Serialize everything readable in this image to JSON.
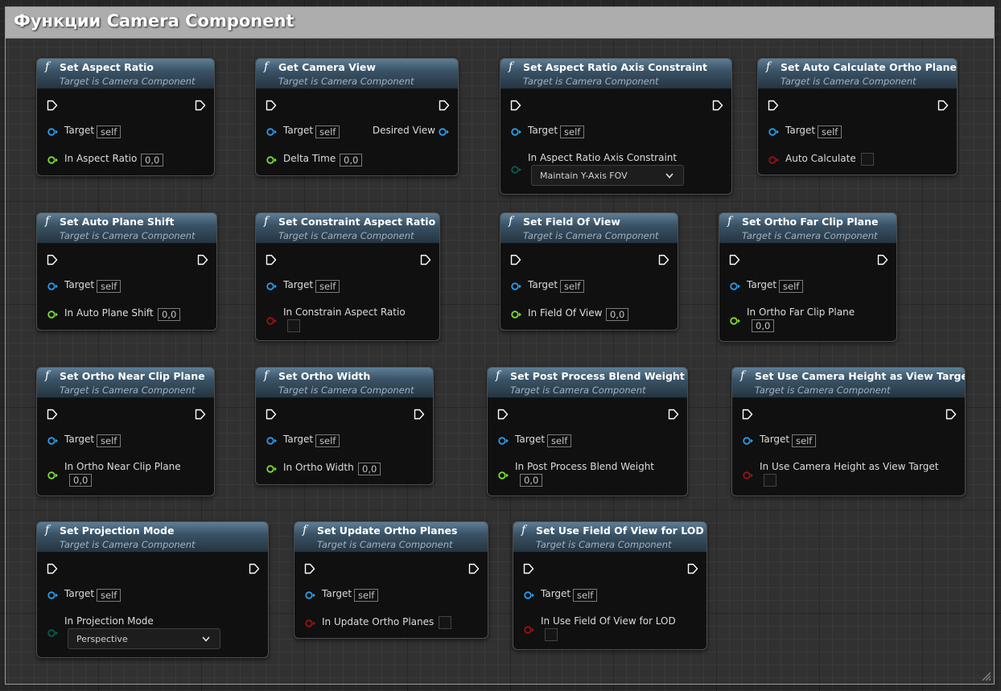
{
  "comment": {
    "title": "Функции Camera Component"
  },
  "subtitle": "Target is Camera Component",
  "target_label": "Target",
  "self_value": "self",
  "colors": {
    "object_pin": "#2a9be9",
    "float_pin": "#7bdc34",
    "bool_pin": "#9a1212",
    "enum_pin": "#0a5a4c",
    "header": "#3a5366"
  },
  "icons": {
    "function": "f",
    "exec": "exec-pin-icon",
    "dropdown": "chevron-down-icon"
  },
  "nodes": [
    {
      "title": "Set Aspect Ratio",
      "param": "In Aspect Ratio",
      "value": "0,0"
    },
    {
      "title": "Get Camera View",
      "param": "Delta Time",
      "value": "0,0",
      "output": "Desired View"
    },
    {
      "title": "Set Aspect Ratio Axis Constraint",
      "param": "In Aspect Ratio Axis Constraint",
      "value": "Maintain Y-Axis FOV"
    },
    {
      "title": "Set Auto Calculate Ortho Planes",
      "param": "Auto Calculate"
    },
    {
      "title": "Set Auto Plane Shift",
      "param": "In Auto Plane Shift",
      "value": "0,0"
    },
    {
      "title": "Set Constraint Aspect Ratio",
      "param": "In Constrain Aspect Ratio"
    },
    {
      "title": "Set Field Of View",
      "param": "In Field Of View",
      "value": "0,0"
    },
    {
      "title": "Set Ortho Far Clip Plane",
      "param": "In Ortho Far Clip Plane",
      "value": "0,0"
    },
    {
      "title": "Set Ortho Near Clip Plane",
      "param": "In Ortho Near Clip Plane",
      "value": "0,0"
    },
    {
      "title": "Set Ortho Width",
      "param": "In Ortho Width",
      "value": "0,0"
    },
    {
      "title": "Set Post Process Blend Weight",
      "param": "In Post Process Blend Weight",
      "value": "0,0"
    },
    {
      "title": "Set Use Camera Height as View Target",
      "param": "In Use Camera Height as View Target"
    },
    {
      "title": "Set Projection Mode",
      "param": "In Projection Mode",
      "value": "Perspective"
    },
    {
      "title": "Set Update Ortho Planes",
      "param": "In Update Ortho Planes"
    },
    {
      "title": "Set Use Field Of View for LOD",
      "param": "In Use Field Of View for LOD"
    }
  ]
}
